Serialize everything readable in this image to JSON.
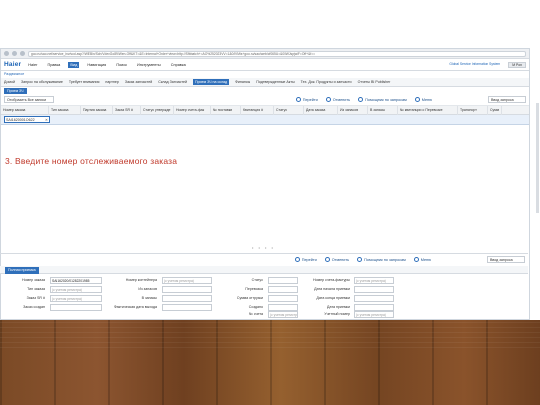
{
  "browser": {
    "url": "goo.ru/sao.net/service_inv/sod.asp?/WEBin/Sch/VdevGo89/Wen-Off&KT=&E=Internal+Order+view=http://Sfbbatch+=AO%252023VV=1&0/lVMis+goo.ru/sao/web/cf065U=&0/lWJspjwiF=Off+&f=="
  },
  "app": {
    "logo": "Haier",
    "menu": [
      "Haier",
      "Правка",
      "Вид",
      "Навигация",
      "Поиск",
      "Инструменты",
      "Справка"
    ],
    "active_menu": "Вид",
    "brand": "Global Service Information System",
    "user": "M Pon"
  },
  "breadcrumb": "Раздвижное",
  "tabs": [
    "Домой",
    "Запрос на обслуживание",
    "Требует внимания",
    "партнер",
    "Заказ запчастей",
    "Склад Запчастей",
    "Прием ЗЧ на склад",
    "Финансы",
    "Подтвержденные Акты",
    "Тех. Док. Продукты и запчасти",
    "Отчеты BI Publisher"
  ],
  "active_tab": "Прием ЗЧ на склад",
  "subtab": "Прием ЗЧ",
  "toolbar": {
    "filter": "Отобразить Все записи",
    "go": "Перейти",
    "cancel": "Отменить",
    "search": "Помощник по запросам",
    "more": "Меню",
    "query": "Ввод запроса"
  },
  "columns": [
    "Номер заказа",
    "Тип заказа",
    "Партия заказа",
    "Заказ SR #",
    "Статус утвержде",
    "Номер счета-фак",
    "№ поставки",
    "Квитанция #",
    "Статус",
    "Дата заказа",
    "Из запасов",
    "В запасы",
    "№ квитанции о Перевозке",
    "Транспорт",
    "Сумм"
  ],
  "filter_value": "SAI1620001O622",
  "instruction": "3. Введите номер отслеживаемого заказа",
  "pager": "• • • •",
  "bottom_toolbar": {
    "go": "Перейти",
    "cancel": "Отменить",
    "search": "Помощник по запросам",
    "more": "Меню",
    "query": "Ввод запроса"
  },
  "panel_tab": "Полная приемка",
  "form": {
    "order_number_label": "Номер заказа",
    "order_number_value": "SAI162020/01282201985",
    "order_type_label": "Тип заказа",
    "order_sr_label": "Заказ SR #",
    "order_created_label": "Заказ создан",
    "container_label": "Номер контейнера",
    "from_stock_label": "Из запасов",
    "to_stock_label": "В запасы",
    "actual_date_label": "Фактическая дата выхода",
    "status_label": "Статус",
    "carrier_label": "Перевозка",
    "amount_label": "Сумма отгрузки",
    "created_label": "Создано",
    "invoice_num_label": "№ счета",
    "invoice_label": "Номер счета-фактуры",
    "start_date_label": "Дата начала приемки",
    "end_date_label": "Дата конца приемки",
    "date_label": "Дата приемки",
    "accounting_label": "Учетный номер",
    "placeholder": "(с учетом регистра)"
  }
}
